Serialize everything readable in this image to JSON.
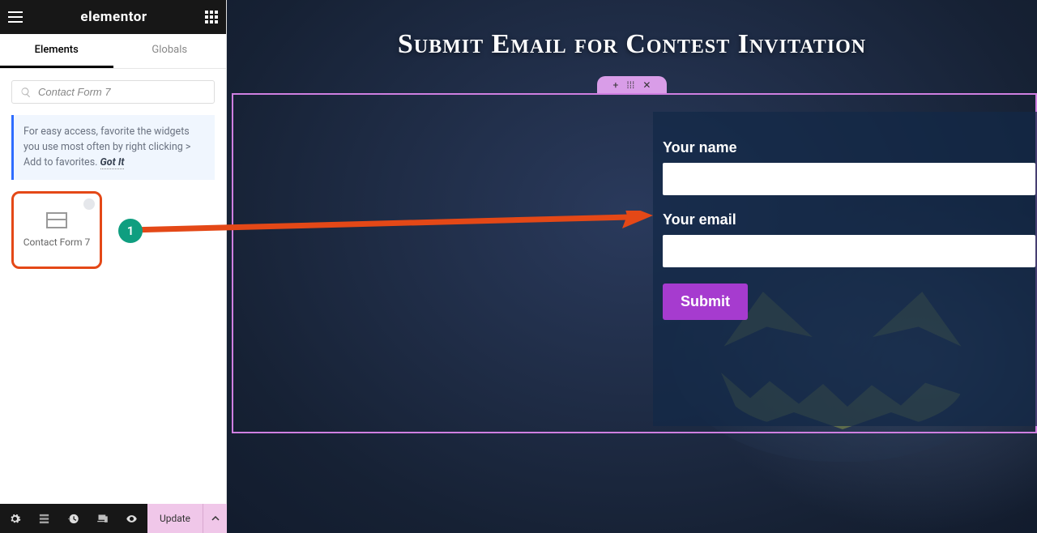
{
  "brand": "elementor",
  "tabs": {
    "elements": "Elements",
    "globals": "Globals"
  },
  "search": {
    "value": "Contact Form 7"
  },
  "tip": {
    "text": "For easy access, favorite the widgets you use most often by right clicking > Add to favorites.",
    "action": "Got It"
  },
  "widget": {
    "name": "Contact Form 7"
  },
  "footer": {
    "update_label": "Update"
  },
  "badge": {
    "num": "1"
  },
  "preview": {
    "heading": "Submit Email for Contest Invitation",
    "name_label": "Your name",
    "email_label": "Your email",
    "submit_label": "Submit",
    "section_controls": {
      "plus": "+",
      "grip": "⁞⁞⁞",
      "close": "✕"
    }
  },
  "collapse": "‹"
}
